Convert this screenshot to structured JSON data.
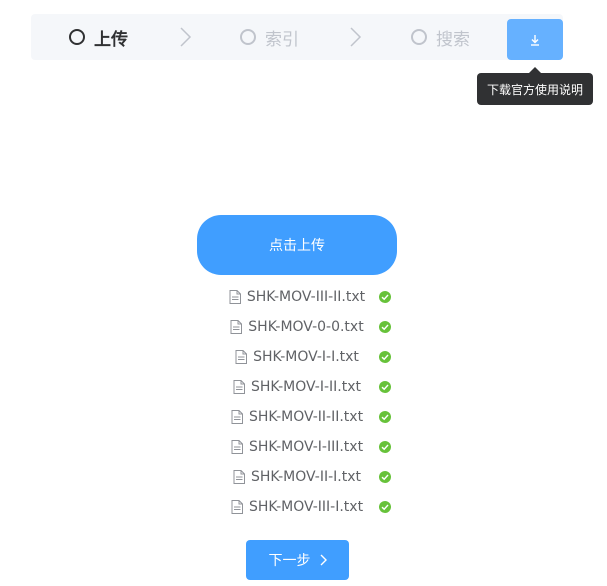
{
  "steps": [
    {
      "label": "上传",
      "state": "active"
    },
    {
      "label": "索引",
      "state": "inactive"
    },
    {
      "label": "搜索",
      "state": "inactive"
    }
  ],
  "download": {
    "icon": "download-icon",
    "tooltip": "下载官方使用说明"
  },
  "upload": {
    "label": "点击上传"
  },
  "files": [
    {
      "name": "SHK-MOV-III-II.txt",
      "status": "success"
    },
    {
      "name": "SHK-MOV-0-0.txt",
      "status": "success"
    },
    {
      "name": "SHK-MOV-I-I.txt",
      "status": "success"
    },
    {
      "name": "SHK-MOV-I-II.txt",
      "status": "success"
    },
    {
      "name": "SHK-MOV-II-II.txt",
      "status": "success"
    },
    {
      "name": "SHK-MOV-I-III.txt",
      "status": "success"
    },
    {
      "name": "SHK-MOV-II-I.txt",
      "status": "success"
    },
    {
      "name": "SHK-MOV-III-I.txt",
      "status": "success"
    }
  ],
  "next": {
    "label": "下一步"
  },
  "colors": {
    "primary": "#409eff",
    "primary_light": "#66b1ff",
    "success": "#67c23a",
    "inactive": "#c0c4cc",
    "active": "#303133"
  }
}
